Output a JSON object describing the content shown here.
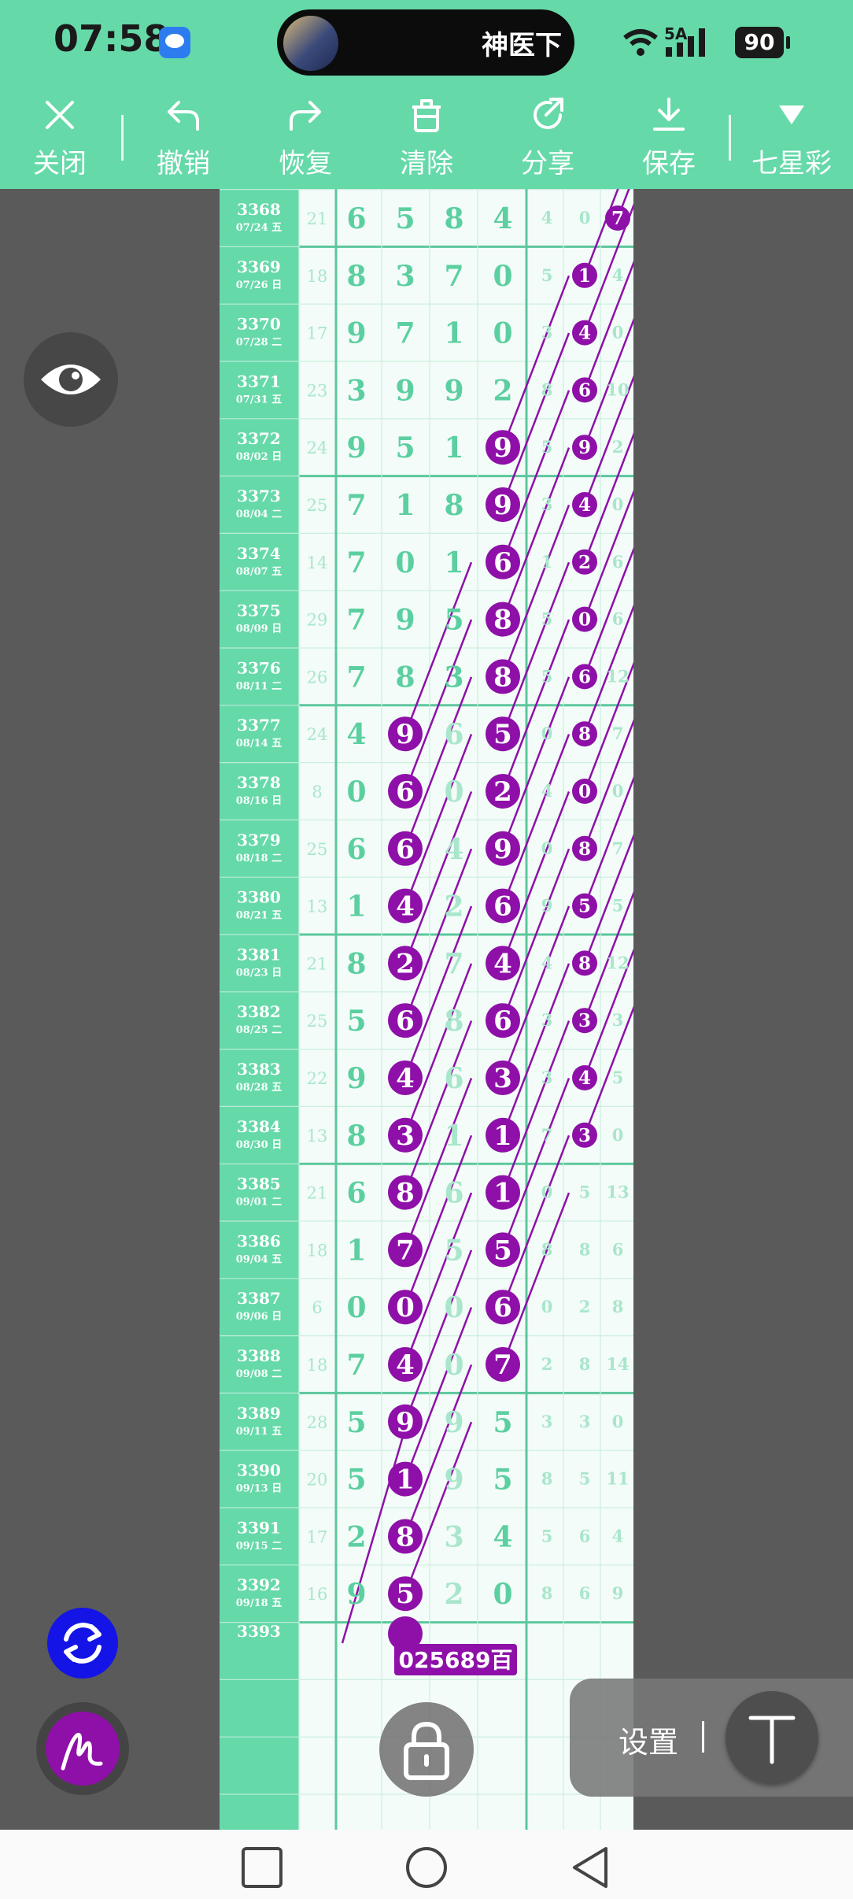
{
  "status_bar": {
    "time": "07:58",
    "island_text": "神医下",
    "network": "5A",
    "battery": "90"
  },
  "toolbar": {
    "close": "关闭",
    "undo": "撤销",
    "redo": "恢复",
    "clear": "清除",
    "share": "分享",
    "save": "保存",
    "lottery": "七星彩"
  },
  "colors": {
    "header": "#66d9a9",
    "mark": "#8e10a8",
    "digit": "#5ccfa0",
    "faded_digit": "#a9e6cc",
    "chart_bg": "#f3fcf8"
  },
  "chart": {
    "partial_row": {
      "issue": "3368",
      "date": "07/24 五",
      "sum": "21",
      "d": [
        6,
        5,
        8,
        4
      ],
      "e": [
        4,
        0,
        7
      ],
      "circled": [
        6
      ]
    },
    "rows": [
      {
        "issue": "3369",
        "date": "07/26 日",
        "sum": "18",
        "d": [
          8,
          3,
          7,
          0
        ],
        "e": [
          5,
          1,
          4
        ],
        "circled": [
          5
        ]
      },
      {
        "issue": "3370",
        "date": "07/28 二",
        "sum": "17",
        "d": [
          9,
          7,
          1,
          0
        ],
        "e": [
          3,
          4,
          0
        ],
        "circled": [
          5
        ]
      },
      {
        "issue": "3371",
        "date": "07/31 五",
        "sum": "23",
        "d": [
          3,
          9,
          9,
          2
        ],
        "e": [
          8,
          6,
          10
        ],
        "circled": [
          5
        ]
      },
      {
        "issue": "3372",
        "date": "08/02 日",
        "sum": "24",
        "d": [
          9,
          5,
          1,
          9
        ],
        "e": [
          5,
          9,
          2
        ],
        "circled": [
          3,
          5
        ]
      },
      {
        "issue": "3373",
        "date": "08/04 二",
        "sum": "25",
        "d": [
          7,
          1,
          8,
          9
        ],
        "e": [
          3,
          4,
          0
        ],
        "circled": [
          3,
          5
        ]
      },
      {
        "issue": "3374",
        "date": "08/07 五",
        "sum": "14",
        "d": [
          7,
          0,
          1,
          6
        ],
        "e": [
          1,
          2,
          6
        ],
        "circled": [
          3,
          5
        ]
      },
      {
        "issue": "3375",
        "date": "08/09 日",
        "sum": "29",
        "d": [
          7,
          9,
          5,
          8
        ],
        "e": [
          5,
          0,
          6
        ],
        "circled": [
          3,
          5
        ]
      },
      {
        "issue": "3376",
        "date": "08/11 二",
        "sum": "26",
        "d": [
          7,
          8,
          3,
          8
        ],
        "e": [
          5,
          6,
          12
        ],
        "circled": [
          3,
          5
        ]
      },
      {
        "issue": "3377",
        "date": "08/14 五",
        "sum": "24",
        "d": [
          4,
          9,
          6,
          5
        ],
        "e": [
          0,
          8,
          7
        ],
        "circled": [
          1,
          3,
          5
        ]
      },
      {
        "issue": "3378",
        "date": "08/16 日",
        "sum": "8",
        "d": [
          0,
          6,
          0,
          2
        ],
        "e": [
          4,
          0,
          0
        ],
        "circled": [
          1,
          3,
          5
        ]
      },
      {
        "issue": "3379",
        "date": "08/18 二",
        "sum": "25",
        "d": [
          6,
          6,
          4,
          9
        ],
        "e": [
          0,
          8,
          7
        ],
        "circled": [
          1,
          3,
          5
        ]
      },
      {
        "issue": "3380",
        "date": "08/21 五",
        "sum": "13",
        "d": [
          1,
          4,
          2,
          6
        ],
        "e": [
          9,
          5,
          5
        ],
        "circled": [
          1,
          3,
          5
        ]
      },
      {
        "issue": "3381",
        "date": "08/23 日",
        "sum": "21",
        "d": [
          8,
          2,
          7,
          4
        ],
        "e": [
          4,
          8,
          12
        ],
        "circled": [
          1,
          3,
          5
        ]
      },
      {
        "issue": "3382",
        "date": "08/25 二",
        "sum": "25",
        "d": [
          5,
          6,
          8,
          6
        ],
        "e": [
          3,
          3,
          3
        ],
        "circled": [
          1,
          3,
          5
        ]
      },
      {
        "issue": "3383",
        "date": "08/28 五",
        "sum": "22",
        "d": [
          9,
          4,
          6,
          3
        ],
        "e": [
          3,
          4,
          5
        ],
        "circled": [
          1,
          3,
          5
        ]
      },
      {
        "issue": "3384",
        "date": "08/30 日",
        "sum": "13",
        "d": [
          8,
          3,
          1,
          1
        ],
        "e": [
          7,
          3,
          0
        ],
        "circled": [
          1,
          3,
          5
        ]
      },
      {
        "issue": "3385",
        "date": "09/01 二",
        "sum": "21",
        "d": [
          6,
          8,
          6,
          1
        ],
        "e": [
          0,
          5,
          13
        ],
        "circled": [
          1,
          3
        ]
      },
      {
        "issue": "3386",
        "date": "09/04 五",
        "sum": "18",
        "d": [
          1,
          7,
          5,
          5
        ],
        "e": [
          8,
          8,
          6
        ],
        "circled": [
          1,
          3
        ]
      },
      {
        "issue": "3387",
        "date": "09/06 日",
        "sum": "6",
        "d": [
          0,
          0,
          0,
          6
        ],
        "e": [
          0,
          2,
          8
        ],
        "circled": [
          1,
          3
        ]
      },
      {
        "issue": "3388",
        "date": "09/08 二",
        "sum": "18",
        "d": [
          7,
          4,
          0,
          7
        ],
        "e": [
          2,
          8,
          14
        ],
        "circled": [
          1,
          3
        ]
      },
      {
        "issue": "3389",
        "date": "09/11 五",
        "sum": "28",
        "d": [
          5,
          9,
          9,
          5
        ],
        "e": [
          3,
          3,
          0
        ],
        "circled": [
          1
        ]
      },
      {
        "issue": "3390",
        "date": "09/13 日",
        "sum": "20",
        "d": [
          5,
          1,
          9,
          5
        ],
        "e": [
          8,
          5,
          11
        ],
        "circled": [
          1
        ]
      },
      {
        "issue": "3391",
        "date": "09/15 二",
        "sum": "17",
        "d": [
          2,
          8,
          3,
          4
        ],
        "e": [
          5,
          6,
          4
        ],
        "circled": [
          1
        ]
      },
      {
        "issue": "3392",
        "date": "09/18 五",
        "sum": "16",
        "d": [
          9,
          5,
          2,
          0
        ],
        "e": [
          8,
          6,
          9
        ],
        "circled": [
          1
        ]
      }
    ],
    "next_issue": "3393",
    "prediction_label": "025689百"
  },
  "controls": {
    "settings_label": "设置",
    "text_tool_glyph": "T"
  }
}
